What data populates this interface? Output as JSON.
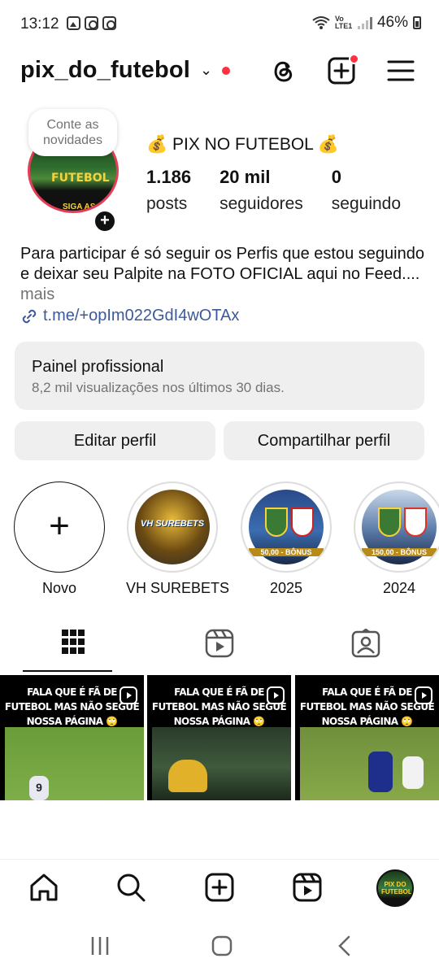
{
  "status_bar": {
    "time": "13:12",
    "battery": "46%",
    "network_label": "Vo LTE1"
  },
  "header": {
    "username": "pix_do_futebol",
    "has_notification": true
  },
  "profile": {
    "note": "Conte as novidades",
    "avatar_text": "FUTEBOL",
    "avatar_subtext": "SIGA AS REGRAS",
    "display_name": "💰 PIX NO FUTEBOL 💰",
    "stats": [
      {
        "value": "1.186",
        "label": "posts"
      },
      {
        "value": "20 mil",
        "label": "seguidores"
      },
      {
        "value": "0",
        "label": "seguindo"
      }
    ],
    "bio": "Para participar é só seguir os Perfis que estou seguindo e deixar seu Palpite na FOTO OFICIAL aqui no Feed.... ",
    "bio_more": "mais",
    "link": "t.me/+opIm022GdI4wOTAx"
  },
  "panel": {
    "title": "Painel profissional",
    "subtitle": "8,2 mil visualizações nos últimos 30 dias."
  },
  "buttons": {
    "edit": "Editar perfil",
    "share": "Compartilhar perfil"
  },
  "highlights": [
    {
      "label": "Novo",
      "tag": "+"
    },
    {
      "label": "VH SUREBETS",
      "tag": "VH SUREBETS"
    },
    {
      "label": "2025",
      "tag": "50,00 - BÔNUS"
    },
    {
      "label": "2024",
      "tag": "150,00 - BÔNUS"
    }
  ],
  "tabs": [
    "grid-icon",
    "reels-icon",
    "tagged-icon"
  ],
  "posts": [
    {
      "caption": "FALA QUE É FÃ DE FUTEBOL MAS NÃO SEGUE NOSSA PÁGINA 🙄",
      "player_number": "9"
    },
    {
      "caption": "FALA QUE É FÃ DE FUTEBOL MAS NÃO SEGUE NOSSA PÁGINA 🙄"
    },
    {
      "caption": "FALA QUE É FÃ DE FUTEBOL MAS NÃO SEGUE NOSSA PÁGINA 🙄"
    }
  ],
  "bottom_nav": [
    "home-icon",
    "search-icon",
    "create-icon",
    "reels-icon",
    "profile-avatar"
  ],
  "bottom_nav_profile_text": "PIX DO FUTEBOL",
  "colors": {
    "accent_red": "#ff3040",
    "link_blue": "#3c5a99",
    "muted_gray": "#737373",
    "button_gray": "#efefef"
  }
}
